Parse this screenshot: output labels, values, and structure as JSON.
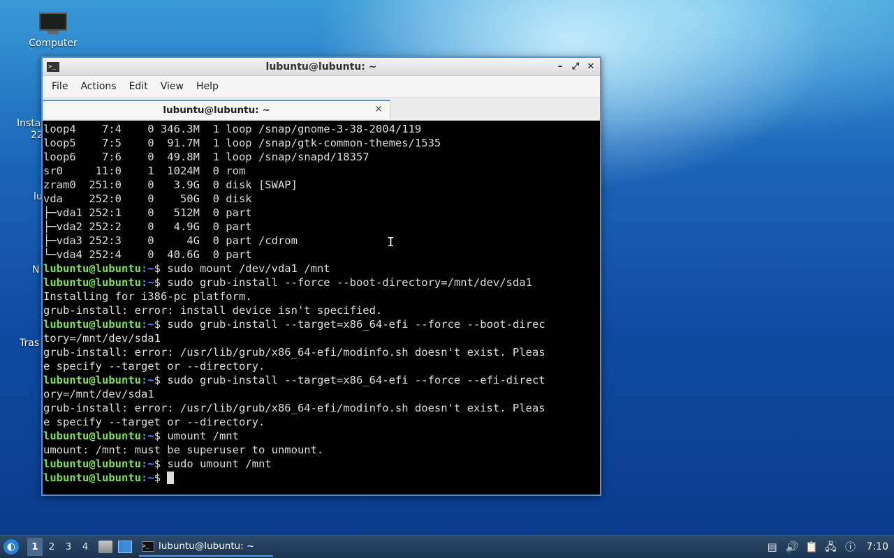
{
  "desktop": {
    "icons": [
      {
        "label": "Computer"
      }
    ],
    "partial_labels": [
      "Insta",
      "22",
      "lu",
      "N",
      "Tras"
    ]
  },
  "window": {
    "title": "lubuntu@lubuntu: ~",
    "menu": [
      "File",
      "Actions",
      "Edit",
      "View",
      "Help"
    ],
    "tab_label": "lubuntu@lubuntu: ~",
    "terminal": {
      "prompt_user": "lubuntu@lubuntu",
      "prompt_path": ":~",
      "lines": [
        {
          "kind": "out",
          "text": "loop4    7:4    0 346.3M  1 loop /snap/gnome-3-38-2004/119"
        },
        {
          "kind": "out",
          "text": "loop5    7:5    0  91.7M  1 loop /snap/gtk-common-themes/1535"
        },
        {
          "kind": "out",
          "text": "loop6    7:6    0  49.8M  1 loop /snap/snapd/18357"
        },
        {
          "kind": "out",
          "text": "sr0     11:0    1  1024M  0 rom"
        },
        {
          "kind": "out",
          "text": "zram0  251:0    0   3.9G  0 disk [SWAP]"
        },
        {
          "kind": "out",
          "text": "vda    252:0    0    50G  0 disk"
        },
        {
          "kind": "out",
          "text": "├─vda1 252:1    0   512M  0 part"
        },
        {
          "kind": "out",
          "text": "├─vda2 252:2    0   4.9G  0 part"
        },
        {
          "kind": "out",
          "text": "├─vda3 252:3    0     4G  0 part /cdrom"
        },
        {
          "kind": "out",
          "text": "└─vda4 252:4    0  40.6G  0 part"
        },
        {
          "kind": "cmd",
          "text": "$ sudo mount /dev/vda1 /mnt"
        },
        {
          "kind": "cmd",
          "text": "$ sudo grub-install --force --boot-directory=/mnt/dev/sda1"
        },
        {
          "kind": "out",
          "text": "Installing for i386-pc platform."
        },
        {
          "kind": "out",
          "text": "grub-install: error: install device isn't specified."
        },
        {
          "kind": "cmd",
          "text": "$ sudo grub-install --target=x86_64-efi --force --boot-direc"
        },
        {
          "kind": "out",
          "text": "tory=/mnt/dev/sda1"
        },
        {
          "kind": "out",
          "text": "grub-install: error: /usr/lib/grub/x86_64-efi/modinfo.sh doesn't exist. Pleas"
        },
        {
          "kind": "out",
          "text": "e specify --target or --directory."
        },
        {
          "kind": "cmd",
          "text": "$ sudo grub-install --target=x86_64-efi --force --efi-direct"
        },
        {
          "kind": "out",
          "text": "ory=/mnt/dev/sda1"
        },
        {
          "kind": "out",
          "text": "grub-install: error: /usr/lib/grub/x86_64-efi/modinfo.sh doesn't exist. Pleas"
        },
        {
          "kind": "out",
          "text": "e specify --target or --directory."
        },
        {
          "kind": "cmd",
          "text": "$ umount /mnt"
        },
        {
          "kind": "out",
          "text": "umount: /mnt: must be superuser to unmount."
        },
        {
          "kind": "cmd",
          "text": "$ sudo umount /mnt"
        },
        {
          "kind": "cmd",
          "text": "$ "
        }
      ]
    }
  },
  "taskbar": {
    "workspaces": [
      "1",
      "2",
      "3",
      "4"
    ],
    "active_workspace": "1",
    "task_label": "lubuntu@lubuntu: ~",
    "clock": "7:10"
  }
}
